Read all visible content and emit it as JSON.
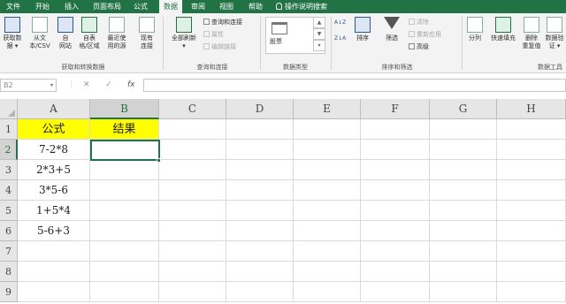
{
  "menu": {
    "tabs": [
      "文件",
      "开始",
      "插入",
      "页面布局",
      "公式",
      "数据",
      "审阅",
      "视图",
      "帮助"
    ],
    "active_tab": "数据",
    "tell_me": "操作说明搜索"
  },
  "ribbon": {
    "get_data": {
      "buttons": [
        {
          "label1": "获取数",
          "label2": "据 ▾"
        },
        {
          "label1": "从文",
          "label2": "本/CSV"
        },
        {
          "label1": "自",
          "label2": "网站"
        },
        {
          "label1": "自表",
          "label2": "格/区域"
        },
        {
          "label1": "最近使",
          "label2": "用的源"
        },
        {
          "label1": "现有",
          "label2": "连接"
        }
      ],
      "group_label": "获取和转换数据"
    },
    "queries": {
      "refresh_label1": "全部刷新",
      "refresh_label2": "▾",
      "items": [
        "查询和连接",
        "属性",
        "编辑链接"
      ],
      "group_label": "查询和连接"
    },
    "data_types": {
      "gallery_item": "股票",
      "group_label": "数据类型"
    },
    "sort_filter": {
      "sort_az": "A↓Z",
      "sort_za": "Z↓A",
      "sort_label": "排序",
      "filter_label": "筛选",
      "items": [
        "清除",
        "重新应用",
        "高级"
      ],
      "group_label": "排序和筛选"
    },
    "data_tools": {
      "buttons": [
        {
          "label1": "分列",
          "label2": ""
        },
        {
          "label1": "快速填充",
          "label2": ""
        },
        {
          "label1": "删除",
          "label2": "重复值"
        },
        {
          "label1": "数据验",
          "label2": "证 ▾"
        }
      ],
      "group_label": "数据工具"
    }
  },
  "formula_bar": {
    "name_box": "B2",
    "cancel": "✕",
    "confirm": "✓",
    "fx": "fx",
    "value": ""
  },
  "sheet": {
    "columns": [
      "A",
      "B",
      "C",
      "D",
      "E",
      "F",
      "G",
      "H"
    ],
    "rows": [
      "1",
      "2",
      "3",
      "4",
      "5",
      "6",
      "7",
      "8",
      "9"
    ],
    "selected_cell": "B2",
    "cells": {
      "A1": "公式",
      "B1": "结果",
      "A2": "7-2*8",
      "A3": "2*3+5",
      "A4": "3*5-6",
      "A5": "1+5*4",
      "A6": "5-6+3"
    },
    "header_fill": "#ffff00",
    "accent": "#217346"
  }
}
